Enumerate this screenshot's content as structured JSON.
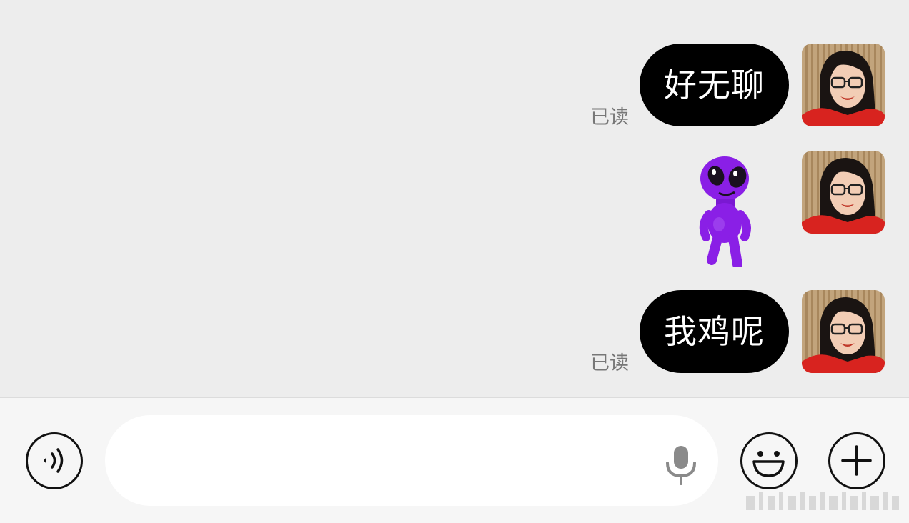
{
  "messages": [
    {
      "type": "text",
      "text": "好无聊",
      "status": "已读"
    },
    {
      "type": "sticker",
      "sticker": "purple-alien-dancing"
    },
    {
      "type": "text",
      "text": "我鸡呢",
      "status": "已读"
    }
  ],
  "input": {
    "value": "",
    "placeholder": ""
  },
  "icons": {
    "voice": "voice-mode-icon",
    "mic": "microphone-icon",
    "emoji": "emoji-smile-icon",
    "plus": "plus-icon"
  },
  "colors": {
    "background": "#ededed",
    "bubble": "#000000",
    "bubble_text": "#ffffff",
    "input_bar": "#f6f6f6",
    "sticker": "#8a1fe6"
  }
}
